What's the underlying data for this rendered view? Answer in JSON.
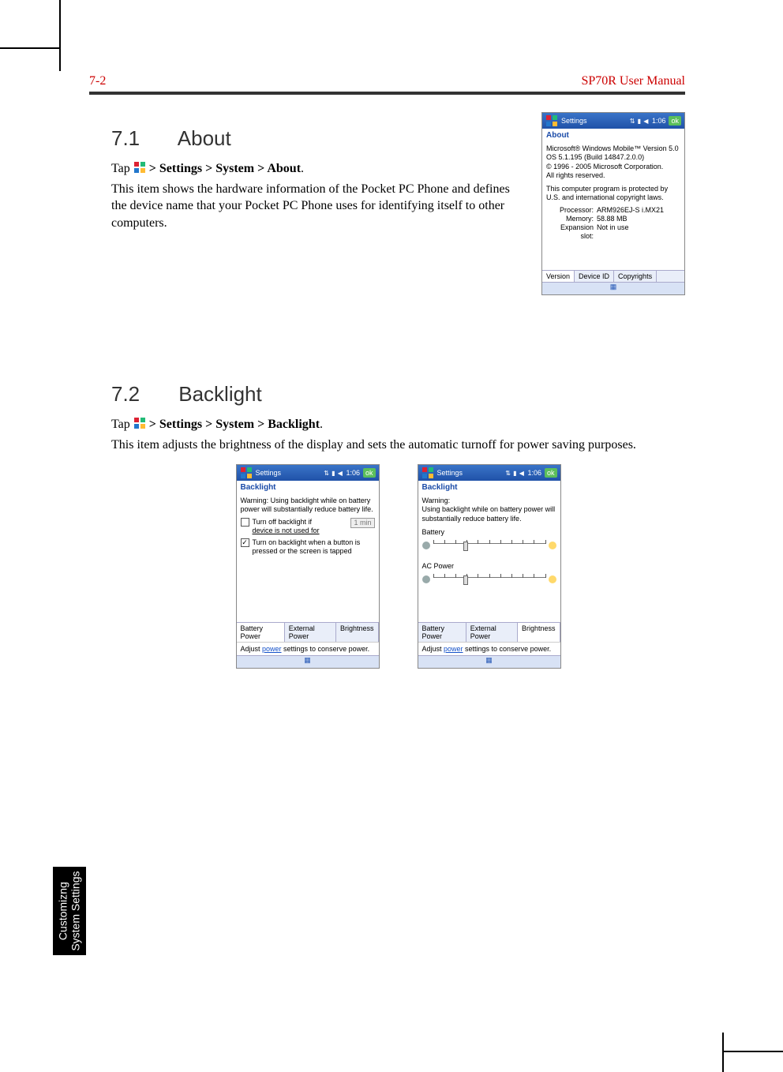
{
  "header": {
    "page_number": "7-2",
    "doc_title": "SP70R User Manual"
  },
  "side_tab": {
    "line1": "Customizng",
    "line2": "System Settings"
  },
  "sec1": {
    "number": "7.1",
    "title": "About",
    "tap_prefix": "Tap ",
    "tap_path": " > Settings > System > About",
    "tap_suffix": ".",
    "desc": "This item shows the hardware information of the Pocket PC Phone and defines the device name that your Pocket PC Phone uses for identifying itself to other computers."
  },
  "about_shot": {
    "titlebar": "Settings",
    "time": "1:06",
    "ok": "ok",
    "subtitle": "About",
    "line1": "Microsoft® Windows Mobile™ Version 5.0",
    "line2": "OS 5.1.195 (Build 14847.2.0.0)",
    "line3": "© 1996 - 2005 Microsoft Corporation.",
    "line4": "All rights reserved.",
    "line5": "This computer program is protected by U.S. and international copyright laws.",
    "proc_k": "Processor:",
    "proc_v": "ARM926EJ-S i.MX21",
    "mem_k": "Memory:",
    "mem_v": "58.88 MB",
    "exp_k": "Expansion slot:",
    "exp_v": "Not in use",
    "tabs": [
      "Version",
      "Device ID",
      "Copyrights"
    ]
  },
  "sec2": {
    "number": "7.2",
    "title": "Backlight",
    "tap_prefix": "Tap ",
    "tap_path": " > Settings > System > Backlight",
    "tap_suffix": ".",
    "desc": "This item adjusts the brightness of the display and sets the automatic turnoff for power saving purposes."
  },
  "bl_shot_a": {
    "titlebar": "Settings",
    "time": "1:06",
    "ok": "ok",
    "subtitle": "Backlight",
    "warn": "Warning: Using backlight while on battery power will substantially reduce battery life.",
    "cb1_a": "Turn off backlight if",
    "cb1_b": "device is not used for",
    "select1": "1 min",
    "cb2": "Turn on backlight when a button is pressed or the screen is tapped",
    "tabs": [
      "Battery Power",
      "External Power",
      "Brightness"
    ],
    "hint_a": "Adjust ",
    "hint_link": "power",
    "hint_b": " settings to conserve power."
  },
  "bl_shot_b": {
    "titlebar": "Settings",
    "time": "1:06",
    "ok": "ok",
    "subtitle": "Backlight",
    "warn1": "Warning:",
    "warn2": "Using backlight while on battery power will substantially reduce battery life.",
    "slider1_label": "Battery",
    "slider2_label": "AC Power",
    "tabs": [
      "Battery Power",
      "External Power",
      "Brightness"
    ],
    "hint_a": "Adjust ",
    "hint_link": "power",
    "hint_b": " settings to conserve power."
  }
}
